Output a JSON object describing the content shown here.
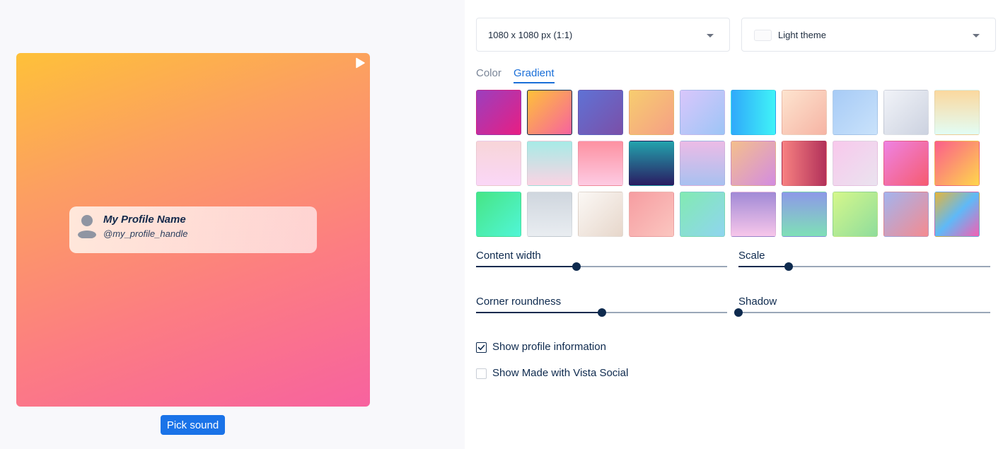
{
  "preview": {
    "profile_name": "My Profile Name",
    "profile_handle": "@my_profile_handle",
    "pick_sound_label": "Pick sound",
    "play_icon": "play-icon",
    "avatar_icon": "user-avatar-icon"
  },
  "settings": {
    "size_select": {
      "value": "1080 x 1080 px (1:1)"
    },
    "theme_select": {
      "value": "Light theme"
    },
    "tabs": [
      {
        "label": "Color",
        "active": false
      },
      {
        "label": "Gradient",
        "active": true
      }
    ],
    "selected_gradient_index": 1,
    "gradients": [
      [
        "#9b3fbe",
        "#e81e83"
      ],
      [
        "#fec139",
        "#f7629f"
      ],
      [
        "#5f72d5",
        "#7b4fa8"
      ],
      [
        "#f7cd6f",
        "#f59f85"
      ],
      [
        "#d9c6fb",
        "#9dc5f6"
      ],
      [
        "#2fa9fb",
        "#40f3f7"
      ],
      [
        "#fde4cf",
        "#f6b4a4"
      ],
      [
        "#a7cbf6",
        "#c9e2fb"
      ],
      [
        "#f1f3f8",
        "#ccd2e0"
      ],
      [
        "#fbd89e",
        "#e2fdf5"
      ],
      [
        "#f8d5d8",
        "#fad7f7"
      ],
      [
        "#a7ebe6",
        "#fbd3e3"
      ],
      [
        "#fd91a1",
        "#fdcbe3"
      ],
      [
        "#23a3ad",
        "#2a1c62"
      ],
      [
        "#ecbbe6",
        "#a8c1f0"
      ],
      [
        "#f4bf8c",
        "#d38ce1"
      ],
      [
        "#f78181",
        "#b2315a"
      ],
      [
        "#f8c8ec",
        "#eae3ef"
      ],
      [
        "#ee83e3",
        "#f65b70"
      ],
      [
        "#fb5d8b",
        "#fed74c"
      ],
      [
        "#47e585",
        "#50f6d7"
      ],
      [
        "#cfd6de",
        "#e9edf1"
      ],
      [
        "#fbf8f5",
        "#e7d7cb"
      ],
      [
        "#f69da1",
        "#fbc6c0"
      ],
      [
        "#82eab2",
        "#8fd5ef"
      ],
      [
        "#a18ad6",
        "#f7c6ea"
      ],
      [
        "#8d99e8",
        "#7fe0b7"
      ],
      [
        "#d5f78b",
        "#8fdd9c"
      ],
      [
        "#a3b4ee",
        "#f58a8f"
      ],
      [
        "#e4b53c",
        "#5fb9f7",
        "#f45fb2"
      ]
    ],
    "sliders": {
      "content_width": {
        "label": "Content width",
        "value": 0.4
      },
      "scale": {
        "label": "Scale",
        "value": 0.2
      },
      "corner_roundness": {
        "label": "Corner roundness",
        "value": 0.5
      },
      "shadow": {
        "label": "Shadow",
        "value": 0
      }
    },
    "checkboxes": {
      "show_profile": {
        "label": "Show profile information",
        "checked": true
      },
      "show_vista": {
        "label": "Show Made with Vista Social",
        "checked": false
      }
    }
  },
  "colors": {
    "accent": "#1a73e8",
    "text": "#0e2a4e",
    "canvas_gradient": [
      "#fec139",
      "#fc9f61",
      "#fc7d82",
      "#f7629f"
    ]
  }
}
